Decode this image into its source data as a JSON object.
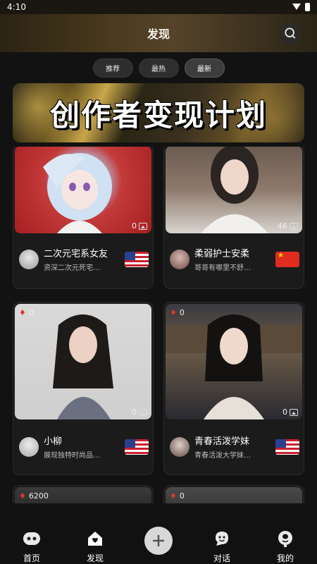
{
  "status": {
    "time": "4:10"
  },
  "header": {
    "title": "发现"
  },
  "tabs": [
    {
      "label": "推荐"
    },
    {
      "label": "最热"
    },
    {
      "label": "最新"
    }
  ],
  "banner": {
    "text": "创作者变现计划"
  },
  "cards": [
    {
      "name": "二次元宅系女友",
      "desc": "资深二次元死宅…",
      "photo_count": "0",
      "flag": "us"
    },
    {
      "name": "柔弱护士安柔",
      "desc": "哥哥有哪里不舒…",
      "photo_count": "46",
      "flag": "cn"
    },
    {
      "name": "小柳",
      "desc": "展现独特时尚品…",
      "photo_count": "0",
      "likes": "0",
      "flag": "us"
    },
    {
      "name": "青春活泼学妹",
      "desc": "青春活泼大学妹…",
      "photo_count": "0",
      "likes": "0",
      "flag": "us"
    },
    {
      "likes": "6200"
    },
    {
      "likes": "0"
    }
  ],
  "nav": {
    "home": "首页",
    "discover": "发现",
    "chat": "对话",
    "mine": "我的"
  }
}
